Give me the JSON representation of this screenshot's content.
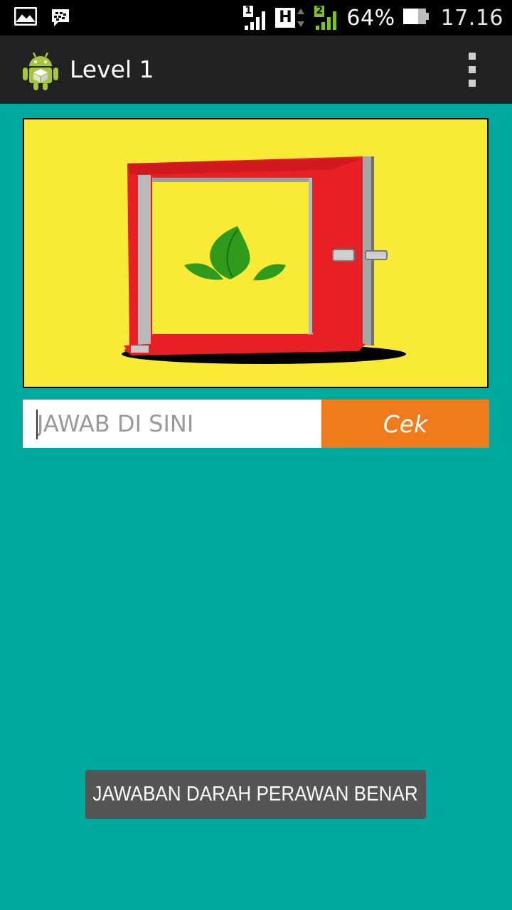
{
  "status_bar": {
    "sim1_label": "1",
    "network_type": "H",
    "sim2_label": "2",
    "battery_percent": "64%",
    "time": "17.16",
    "icons": [
      "gallery-notification-icon",
      "bbm-notification-icon",
      "signal-sim1-icon",
      "hspa-icon",
      "signal-sim2-icon",
      "battery-icon"
    ]
  },
  "action_bar": {
    "title": "Level 1",
    "app_icon": "android-robot-icon",
    "menu_icon": "overflow-menu-icon"
  },
  "puzzle": {
    "image": "red-door-with-green-leaf-icon"
  },
  "answer": {
    "placeholder": "JAWAB DI SINI",
    "value": "",
    "check_label": "Cek"
  },
  "toast": {
    "message": "JAWABAN DARAH PERAWAN BENAR"
  },
  "colors": {
    "background": "#00a99d",
    "action_bar": "#222222",
    "image_bg": "#f9eb35",
    "check_button": "#ee7b1c",
    "toast": "#555555"
  }
}
